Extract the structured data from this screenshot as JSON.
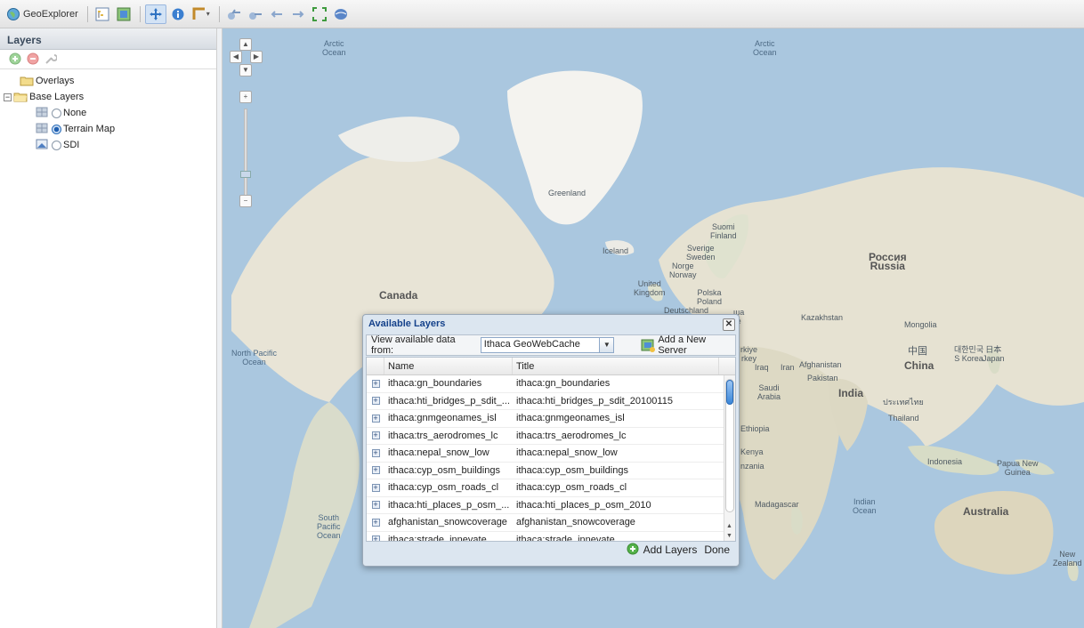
{
  "toolbar": {
    "app_title": "GeoExplorer",
    "icons": [
      "globe-icon",
      "layer-tree-icon",
      "legend-icon",
      "pan-icon",
      "info-icon",
      "measure-icon",
      "dropdown-arrow-icon",
      "nav-back-icon",
      "nav-forward-icon",
      "zoom-previous-icon",
      "zoom-next-icon",
      "zoom-extent-icon",
      "world-icon"
    ]
  },
  "sidebar": {
    "title": "Layers",
    "tree": [
      {
        "label": "Overlays",
        "type": "folder"
      },
      {
        "label": "Base Layers",
        "type": "folder-open"
      },
      {
        "label": "None",
        "type": "radio",
        "checked": false
      },
      {
        "label": "Terrain Map",
        "type": "radio",
        "checked": true
      },
      {
        "label": "SDI",
        "type": "radio",
        "checked": false
      }
    ]
  },
  "map": {
    "labels": {
      "arctic1": "Arctic\nOcean",
      "arctic2": "Arctic\nOcean",
      "greenland": "Greenland",
      "iceland": "Iceland",
      "canada": "Canada",
      "suomi": "Suomi\nFinland",
      "sverige": "Sverige\nSweden",
      "norge": "Norge\nNorway",
      "uk": "United\nKingdom",
      "polska": "Polska\nPoland",
      "deutschland": "Deutschland",
      "russia": "Россия\nRussia",
      "kazakhstan": "Kazakhstan",
      "mongolia": "Mongolia",
      "china_native": "中国",
      "china": "China",
      "korea": "대한민국\nS Korea",
      "japan": "日本\nJapan",
      "iraq": "Iraq",
      "iran": "Iran",
      "afghanistan": "Afghanistan",
      "pakistan": "Pakistan",
      "saudi": "Saudi\nArabia",
      "india": "India",
      "thai_native": "ประเทศไทย",
      "thailand": "Thailand",
      "ethiopia": "Ethiopia",
      "kenya": "Kenya",
      "tanzania": "nzania",
      "madagascar": "Madagascar",
      "indian_ocean": "Indian\nOcean",
      "indonesia": "Indonesia",
      "png": "Papua New\nGuinea",
      "australia": "Australia",
      "nz": "New\nZealand",
      "north_pacific": "North Pacific\nOcean",
      "south_pacific": "South\nPacific\nOcean",
      "turkey": "rkiye\nrkey",
      "ukraine": "ша\ne"
    }
  },
  "dialog": {
    "title": "Available Layers",
    "view_label": "View available data from:",
    "source_value": "Ithaca GeoWebCache",
    "add_server": "Add a New Server",
    "columns": {
      "name": "Name",
      "title": "Title"
    },
    "rows": [
      {
        "name": "ithaca:gn_boundaries",
        "title": "ithaca:gn_boundaries"
      },
      {
        "name": "ithaca:hti_bridges_p_sdit_...",
        "title": "ithaca:hti_bridges_p_sdit_20100115"
      },
      {
        "name": "ithaca:gnmgeonames_isl",
        "title": "ithaca:gnmgeonames_isl"
      },
      {
        "name": "ithaca:trs_aerodromes_lc",
        "title": "ithaca:trs_aerodromes_lc"
      },
      {
        "name": "ithaca:nepal_snow_low",
        "title": "ithaca:nepal_snow_low"
      },
      {
        "name": "ithaca:cyp_osm_buildings",
        "title": "ithaca:cyp_osm_buildings"
      },
      {
        "name": "ithaca:cyp_osm_roads_cl",
        "title": "ithaca:cyp_osm_roads_cl"
      },
      {
        "name": "ithaca:hti_places_p_osm_...",
        "title": "ithaca:hti_places_p_osm_2010"
      },
      {
        "name": "afghanistan_snowcoverage",
        "title": "afghanistan_snowcoverage"
      },
      {
        "name": "ithaca:strade_innevate",
        "title": "ithaca:strade_innevate"
      }
    ],
    "add_layers": "Add Layers",
    "done": "Done"
  }
}
